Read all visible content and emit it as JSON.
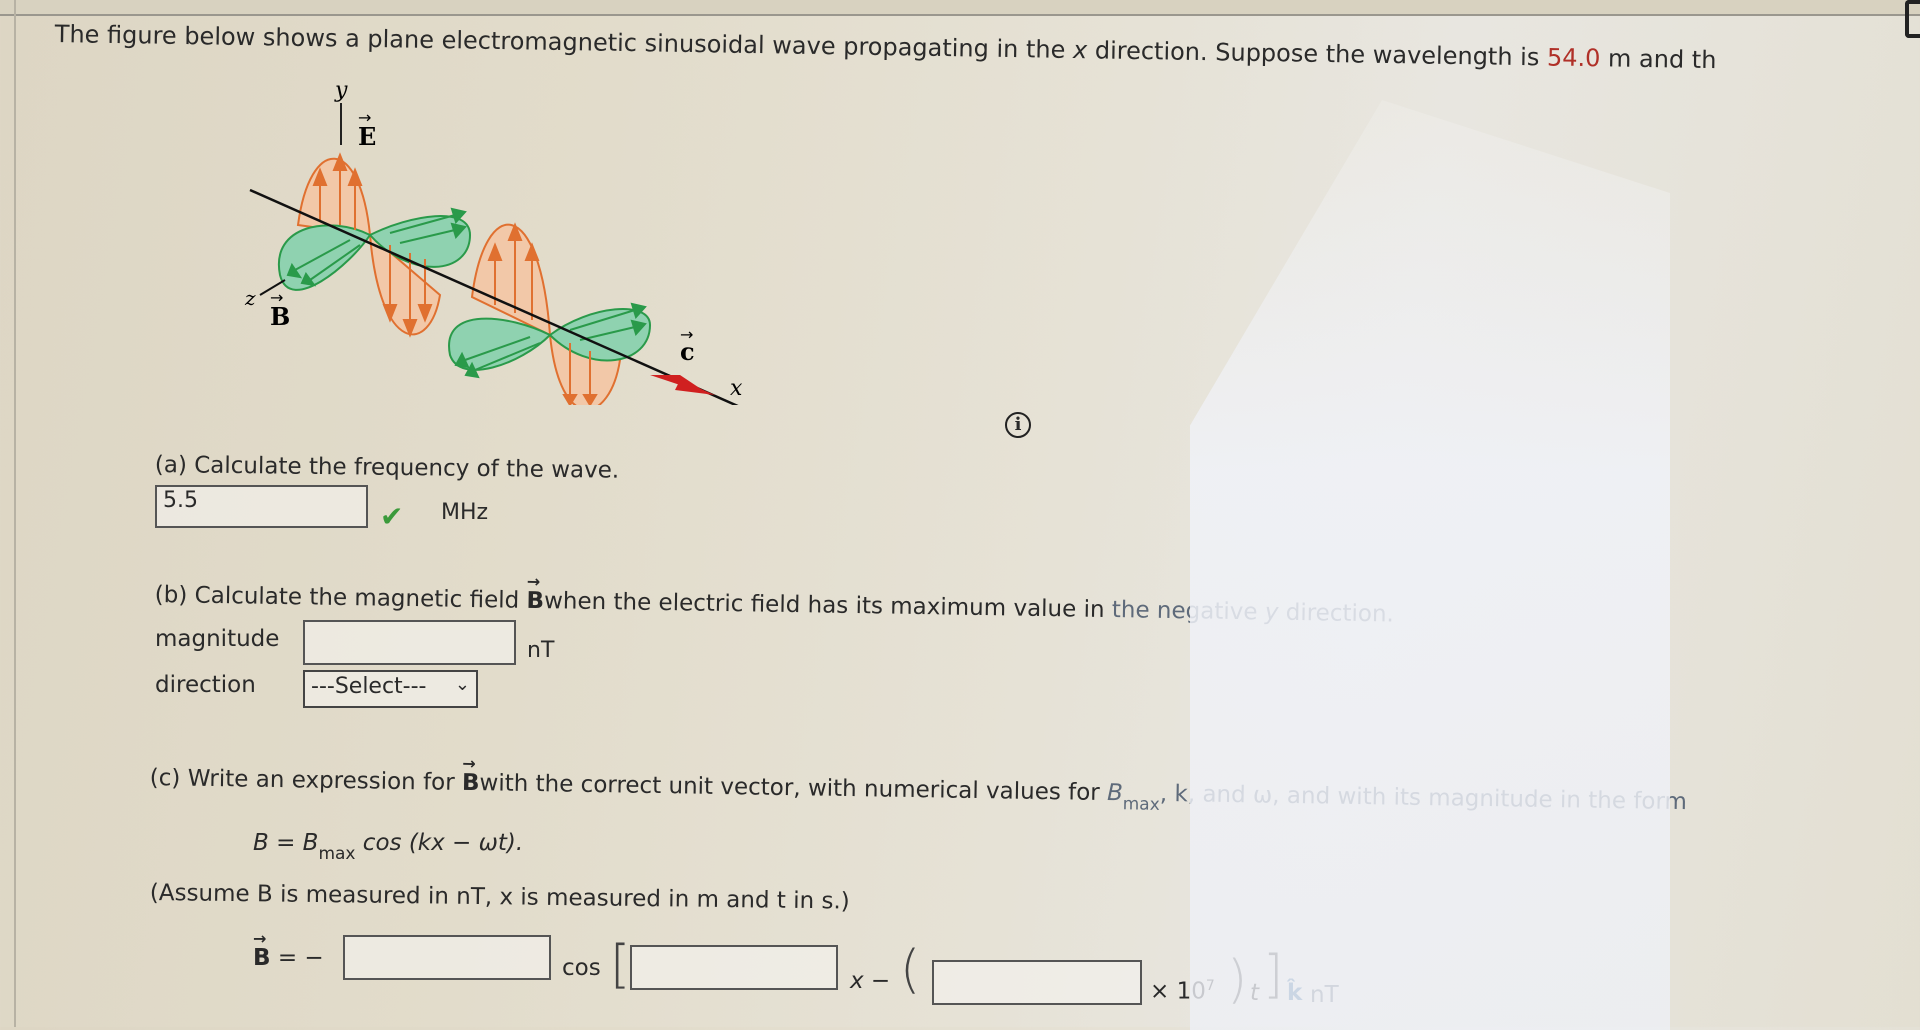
{
  "intro": {
    "text_part1": "The figure below shows a plane electromagnetic sinusoidal wave propagating in the ",
    "var_x": "x",
    "text_part2": " direction. Suppose the wavelength is ",
    "wavelength_value": "54.0",
    "text_part3": " m and th"
  },
  "figure": {
    "label_y": "y",
    "label_E": "E",
    "label_z": "z",
    "label_B": "B",
    "label_c": "c",
    "label_x": "x",
    "colors": {
      "electric": "#e07030",
      "electric_fill": "#f2c8a8",
      "magnetic": "#2a9a4a",
      "magnetic_fill": "#8fd2b0",
      "c_arrow": "#d02020"
    }
  },
  "info_icon": "info-icon",
  "part_a": {
    "prompt": "(a) Calculate the frequency of the wave.",
    "answer_value": "5.5",
    "status_icon": "checkmark-icon",
    "unit": "MHz"
  },
  "part_b": {
    "prompt_part1": "(b) Calculate the magnetic field ",
    "vector_B": "B",
    "prompt_part2": "when the electric field has its maximum value in ",
    "prompt_part3": "the negative ",
    "var_y": "y",
    "prompt_part4": " direction.",
    "magnitude_label": "magnitude",
    "magnitude_value": "",
    "magnitude_unit": "nT",
    "direction_label": "direction",
    "direction_selected": "---Select---"
  },
  "part_c": {
    "prompt_part1": "(c) Write an expression for ",
    "vector_B": "B",
    "prompt_part2": "with the correct unit vector, with numerical values for ",
    "bmax_B": "B",
    "bmax_sub": "max",
    "prompt_part3": ", k, and ω, and with its magnitude in the form",
    "formula_lhs": "B = B",
    "formula_sub": "max",
    "formula_rhs": " cos (kx − ωt).",
    "assume_text": "(Assume B is measured in nT, x is measured in m and t in s.)",
    "expr": {
      "lhs": "B",
      "equals_minus": " = −",
      "cos": "cos",
      "x_minus": "x −",
      "times_ten": "× 10",
      "exponent": "7",
      "t": "t",
      "unit_vector": "k̂",
      "unit": "nT",
      "bmax_value": "",
      "k_value": "",
      "omega_value": ""
    }
  }
}
